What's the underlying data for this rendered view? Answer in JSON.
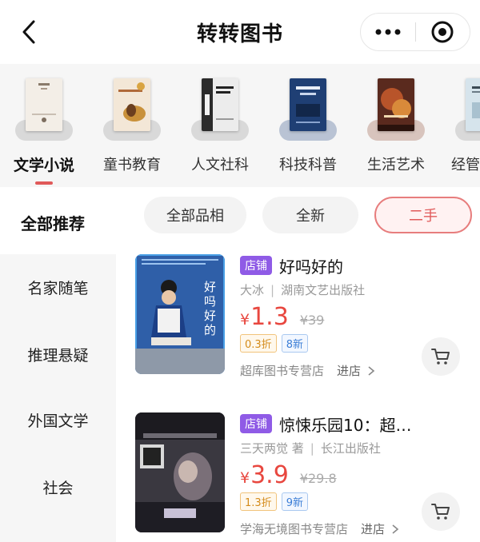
{
  "header": {
    "title": "转转图书",
    "icons": {
      "back": "chevron-left-icon",
      "more": "more-dots-icon",
      "close": "target-icon"
    }
  },
  "categories": [
    {
      "label": "文学小说",
      "active": true,
      "cover_color": "#f0ebe4",
      "cover_text": "城市的冬天"
    },
    {
      "label": "童书教育",
      "active": false,
      "cover_color": "#f3e7d7",
      "cover_text": "问候道的故事"
    },
    {
      "label": "人文社科",
      "active": false,
      "cover_color": "#e9e9e9",
      "cover_text": "焦虑文艺样"
    },
    {
      "label": "科技科普",
      "active": false,
      "cover_color": "#1f3f74",
      "cover_text": "人工智能（第2版）"
    },
    {
      "label": "生活艺术",
      "active": false,
      "cover_color": "#5a2a1e",
      "cover_text": "Lovers"
    },
    {
      "label": "经管…",
      "active": false,
      "cover_color": "#d6e4ec",
      "cover_text": "所有"
    }
  ],
  "filters": {
    "section_title": "全部推荐",
    "chips": [
      {
        "label": "全部品相",
        "active": false
      },
      {
        "label": "全新",
        "active": false
      },
      {
        "label": "二手",
        "active": true
      }
    ]
  },
  "side_categories": [
    "名家随笔",
    "推理悬疑",
    "外国文学",
    "社会"
  ],
  "products": [
    {
      "tag": "店铺",
      "title": "好吗好的",
      "author": "大冰",
      "publisher": "湖南文艺出版社",
      "currency": "¥",
      "price": "1.3",
      "original_price": "¥39",
      "discount": "0.3折",
      "condition": "8新",
      "store": "超库图书专营店",
      "enter_label": "进店",
      "cover_color": "#2f5fa8",
      "cover_text": "好吗好的"
    },
    {
      "tag": "店铺",
      "title": "惊悚乐园10：超…",
      "author": "三天两觉 著",
      "publisher": "长江出版社",
      "currency": "¥",
      "price": "3.9",
      "original_price": "¥29.8",
      "discount": "1.3折",
      "condition": "9新",
      "store": "学海无境图书专营店",
      "enter_label": "进店",
      "cover_color": "#3a3840",
      "cover_text": "惊悚乐园"
    }
  ],
  "colors": {
    "accent_red": "#e05a5a",
    "price_red": "#e8473f",
    "shop_tag_purple": "#8f5be6",
    "discount_orange": "#d48b1a",
    "condition_blue": "#3b7ed6"
  }
}
